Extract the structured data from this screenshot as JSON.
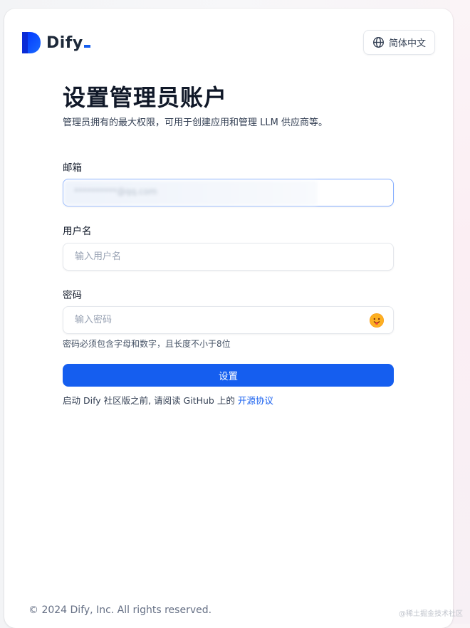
{
  "header": {
    "logo_text": "Dify",
    "language_button": "简体中文",
    "language_icon": "globe-icon"
  },
  "form": {
    "title": "设置管理员账户",
    "subtitle": "管理员拥有的最大权限，可用于创建应用和管理 LLM 供应商等。",
    "email_label": "邮箱",
    "email_value": "**********@qq.com",
    "username_label": "用户名",
    "username_placeholder": "输入用户名",
    "password_label": "密码",
    "password_placeholder": "输入密码",
    "password_toggle_icon": "eye-toggle-emoji-icon",
    "password_hint": "密码必须包含字母和数字，且长度不小于8位",
    "submit_label": "设置",
    "agreement_prefix": "启动 Dify 社区版之前, 请阅读 GitHub 上的",
    "agreement_link": "开源协议"
  },
  "footer": {
    "copyright": "© 2024 Dify, Inc. All rights reserved.",
    "watermark": "@稀土掘金技术社区"
  },
  "colors": {
    "accent": "#155eef",
    "text_primary": "#101828",
    "text_secondary": "#344054",
    "placeholder": "#98a2b3",
    "border": "#e4e7ec"
  }
}
